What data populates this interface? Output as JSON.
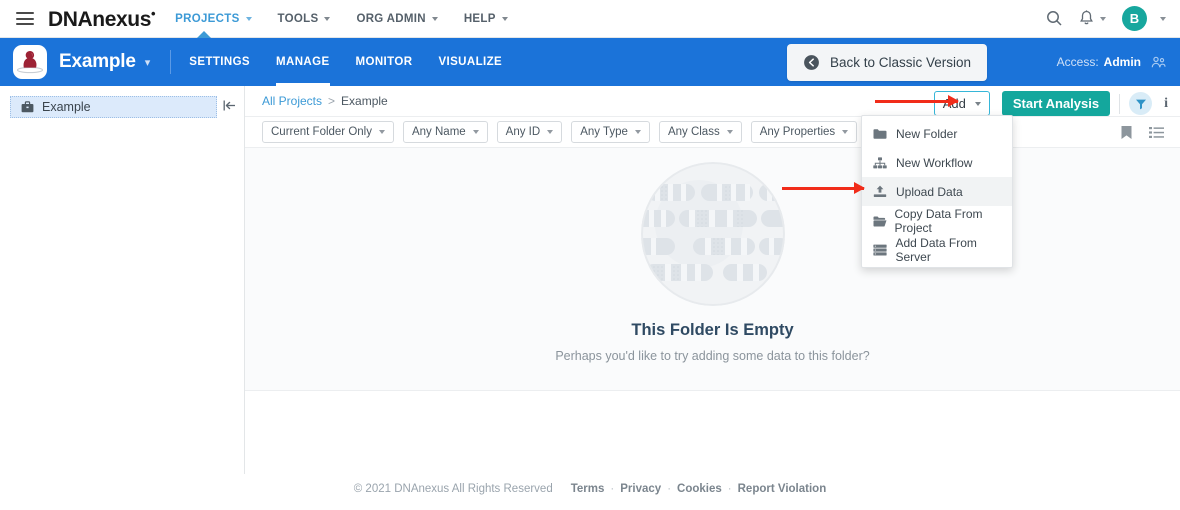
{
  "topnav": {
    "menu_icon": "hamburger-icon",
    "brand": "DNAnexus",
    "brand_mark": "•",
    "items": [
      {
        "label": "PROJECTS",
        "active": true
      },
      {
        "label": "TOOLS",
        "active": false
      },
      {
        "label": "ORG ADMIN",
        "active": false
      },
      {
        "label": "HELP",
        "active": false
      }
    ],
    "search_icon": "search-icon",
    "bell_icon": "bell-icon",
    "avatar_initial": "B"
  },
  "project_bar": {
    "project_name": "Example",
    "project_icon": "project-avatar-icon",
    "tabs": [
      {
        "label": "SETTINGS",
        "active": false
      },
      {
        "label": "MANAGE",
        "active": true
      },
      {
        "label": "MONITOR",
        "active": false
      },
      {
        "label": "VISUALIZE",
        "active": false
      }
    ],
    "classic_button": "Back to Classic Version",
    "classic_icon": "back-arrow-circle-icon",
    "access_label": "Access:",
    "access_value": "Admin",
    "access_icon": "people-icon"
  },
  "sidebar": {
    "items": [
      {
        "label": "Example",
        "icon": "briefcase-icon",
        "selected": true
      }
    ],
    "collapse_icon": "collapse-left-icon"
  },
  "breadcrumb": {
    "root": "All Projects",
    "separator": ">",
    "current": "Example"
  },
  "toolbar": {
    "add_label": "Add",
    "add_caret_icon": "chevron-down-icon",
    "start_analysis_label": "Start Analysis",
    "filter_icon": "funnel-icon",
    "info_icon": "info-icon"
  },
  "filters": [
    {
      "label": "Current Folder Only"
    },
    {
      "label": "Any Name"
    },
    {
      "label": "Any ID"
    },
    {
      "label": "Any Type"
    },
    {
      "label": "Any Class"
    },
    {
      "label": "Any Properties"
    }
  ],
  "filterbar_actions": [
    {
      "icon": "bookmark-icon"
    },
    {
      "icon": "list-view-icon"
    }
  ],
  "add_menu": {
    "items": [
      {
        "label": "New Folder",
        "icon": "folder-icon",
        "highlighted": false
      },
      {
        "label": "New Workflow",
        "icon": "workflow-icon",
        "highlighted": false
      },
      {
        "label": "Upload Data",
        "icon": "upload-icon",
        "highlighted": true
      },
      {
        "label": "Copy Data From Project",
        "icon": "folder-open-icon",
        "highlighted": false
      },
      {
        "label": "Add Data From Server",
        "icon": "server-icon",
        "highlighted": false
      }
    ]
  },
  "empty_state": {
    "illustration": "chromosome-circle-illustration",
    "title": "This Folder Is Empty",
    "subtitle": "Perhaps you'd like to try adding some data to this folder?"
  },
  "footer": {
    "copyright": "© 2021 DNAnexus All Rights Reserved",
    "links": [
      "Terms",
      "Privacy",
      "Cookies",
      "Report Violation"
    ],
    "separator": "·"
  },
  "annotations": [
    {
      "name": "arrow-to-add-button",
      "color": "#f12c1a"
    },
    {
      "name": "arrow-to-upload-data",
      "color": "#f12c1a"
    }
  ],
  "colors": {
    "brand_blue": "#1b73d9",
    "link_blue": "#3c9ad6",
    "teal": "#14a79d",
    "accent_cyan": "#36b6d8",
    "annotation_red": "#f12c1a"
  }
}
